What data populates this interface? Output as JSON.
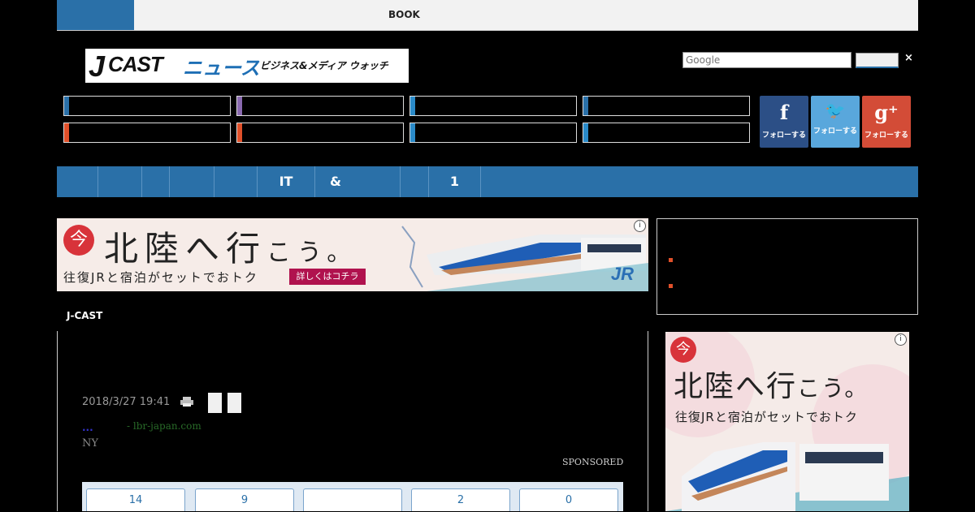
{
  "topbar": {
    "book_label": "BOOK"
  },
  "logo": {
    "j": "J",
    "cast": "CAST",
    "news": "ニュース",
    "tagline": "ビジネス&メディア ウォッチ"
  },
  "search": {
    "placeholder": "Google",
    "close": "×"
  },
  "category_colors": [
    "#2a70a8",
    "#8a6ab0",
    "#2a8ac8",
    "#2a70a8",
    "#e0502a",
    "#e0502a",
    "#2a8ac8",
    "#2a8ac8"
  ],
  "social": [
    {
      "glyph": "f",
      "label": "フォローする",
      "color": "#2c4f86"
    },
    {
      "glyph": "🐦",
      "label": "フォローする",
      "color": "#59a7dc"
    },
    {
      "glyph": "g⁺",
      "label": "フォローする",
      "color": "#d34c37"
    }
  ],
  "nav": {
    "items": [
      "",
      "",
      "",
      "",
      "",
      "IT",
      "&",
      "",
      "1"
    ]
  },
  "ad_banner": {
    "badge": "今",
    "headline": "北陸へ行",
    "headline_small": "こう。",
    "subline": "往復JRと宿泊がセットでおトク",
    "cta": "詳しくはコチラ",
    "brand": "JR",
    "info": "i"
  },
  "ad_side": {
    "badge": "今",
    "headline": "北陸へ行",
    "headline_small": "こう。",
    "subline": "往復JRと宿泊がセットでおトク",
    "info": "i"
  },
  "content": {
    "section_label": "J-CAST",
    "timestamp": "2018/3/27 19:41",
    "sponsor_dots": "...",
    "sponsor_source": "- lbr-japan.com",
    "sponsor_ny": "NY",
    "sponsored": "SPONSORED"
  },
  "counts": [
    "14",
    "9",
    "",
    "2",
    "0"
  ]
}
